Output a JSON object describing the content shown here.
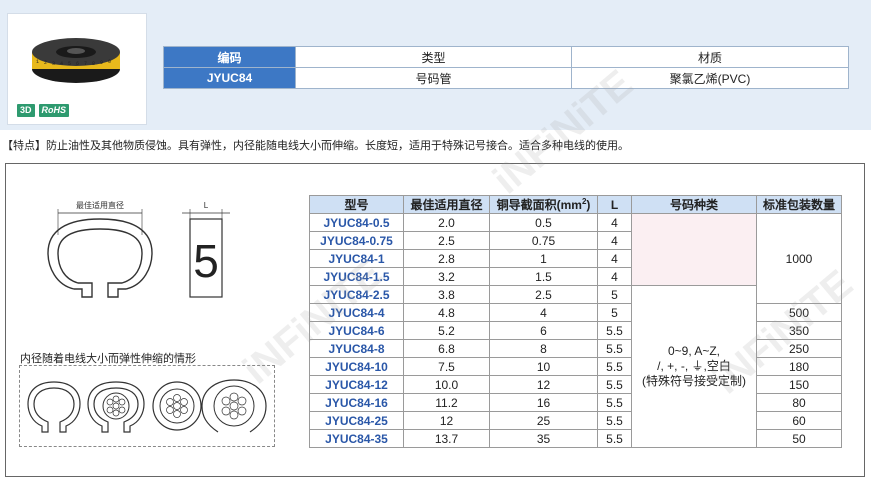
{
  "badges": {
    "b3d": "3D",
    "rohs": "RoHS"
  },
  "spec_table": {
    "headers": {
      "code": "编码",
      "type": "类型",
      "material": "材质"
    },
    "row": {
      "code": "JYUC84",
      "type": "号码管",
      "material": "聚氯乙烯(PVC)"
    }
  },
  "feature_text": "【特点】防止油性及其他物质侵蚀。具有弹性，内径能随电线大小而伸缩。长度短，适用于特殊记号接合。适合多种电线的使用。",
  "diagram": {
    "diameter_label": "最佳适用直径",
    "length_label": "L",
    "number_glyph": "5",
    "elastic_caption": "内径随着电线大小而弹性伸缩的情形"
  },
  "data_table": {
    "headers": {
      "model": "型号",
      "diameter": "最佳适用直径",
      "area": "铜导截面积(mm",
      "area_sup": "2",
      "area_end": ")",
      "L": "L",
      "code_type": "号码种类",
      "package": "标准包装数量"
    },
    "rows": [
      {
        "model": "JYUC84-0.5",
        "diameter": "2.0",
        "area": "0.5",
        "L": "4"
      },
      {
        "model": "JYUC84-0.75",
        "diameter": "2.5",
        "area": "0.75",
        "L": "4"
      },
      {
        "model": "JYUC84-1",
        "diameter": "2.8",
        "area": "1",
        "L": "4"
      },
      {
        "model": "JYUC84-1.5",
        "diameter": "3.2",
        "area": "1.5",
        "L": "4"
      },
      {
        "model": "JYUC84-2.5",
        "diameter": "3.8",
        "area": "2.5",
        "L": "5"
      },
      {
        "model": "JYUC84-4",
        "diameter": "4.8",
        "area": "4",
        "L": "5"
      },
      {
        "model": "JYUC84-6",
        "diameter": "5.2",
        "area": "6",
        "L": "5.5"
      },
      {
        "model": "JYUC84-8",
        "diameter": "6.8",
        "area": "8",
        "L": "5.5"
      },
      {
        "model": "JYUC84-10",
        "diameter": "7.5",
        "area": "10",
        "L": "5.5"
      },
      {
        "model": "JYUC84-12",
        "diameter": "10.0",
        "area": "12",
        "L": "5.5"
      },
      {
        "model": "JYUC84-16",
        "diameter": "11.2",
        "area": "16",
        "L": "5.5"
      },
      {
        "model": "JYUC84-25",
        "diameter": "12",
        "area": "25",
        "L": "5.5"
      },
      {
        "model": "JYUC84-35",
        "diameter": "13.7",
        "area": "35",
        "L": "5.5"
      }
    ],
    "code_type": {
      "line1": "0~9, A~Z,",
      "line2": "/, +, -, ⏚,空白",
      "line3": "(特殊符号接受定制)"
    },
    "package": {
      "p1000": "1000",
      "p500": "500",
      "p350": "350",
      "p250": "250",
      "p180": "180",
      "p150": "150",
      "p80": "80",
      "p60": "60",
      "p50": "50"
    }
  },
  "watermark": "iNFiNiTE"
}
